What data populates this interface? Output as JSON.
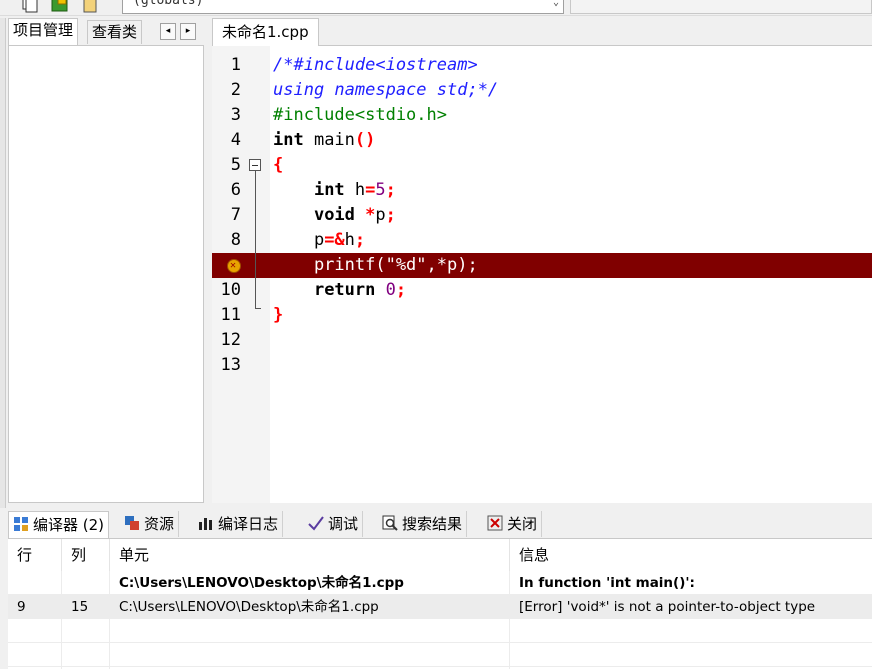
{
  "toolbar": {
    "scope_select": "(globals)"
  },
  "left_tabs": {
    "project": "项目管理",
    "classes": "查看类",
    "prev": "◂",
    "next": "▸"
  },
  "editor": {
    "file_tab": "未命名1.cpp",
    "lines": [
      {
        "n": "1",
        "parts": [
          {
            "t": "/*#include<iostream>",
            "c": "c-comment"
          }
        ]
      },
      {
        "n": "2",
        "parts": [
          {
            "t": "using namespace std;*/",
            "c": "c-comment"
          }
        ]
      },
      {
        "n": "3",
        "parts": [
          {
            "t": "#include<stdio.h>",
            "c": "c-pre"
          }
        ]
      },
      {
        "n": "4",
        "parts": [
          {
            "t": "int",
            "c": "c-kw"
          },
          {
            "t": " main",
            "c": ""
          },
          {
            "t": "()",
            "c": "c-sym"
          }
        ]
      },
      {
        "n": "5",
        "parts": [
          {
            "t": "{",
            "c": "c-sym"
          }
        ]
      },
      {
        "n": "6",
        "parts": [
          {
            "t": "    ",
            "c": ""
          },
          {
            "t": "int",
            "c": "c-kw"
          },
          {
            "t": " h",
            "c": ""
          },
          {
            "t": "=",
            "c": "c-sym"
          },
          {
            "t": "5",
            "c": "c-num"
          },
          {
            "t": ";",
            "c": "c-sym"
          }
        ]
      },
      {
        "n": "7",
        "parts": [
          {
            "t": "    ",
            "c": ""
          },
          {
            "t": "void",
            "c": "c-kw"
          },
          {
            "t": " ",
            "c": ""
          },
          {
            "t": "*",
            "c": "c-sym"
          },
          {
            "t": "p",
            "c": ""
          },
          {
            "t": ";",
            "c": "c-sym"
          }
        ]
      },
      {
        "n": "8",
        "parts": [
          {
            "t": "    p",
            "c": ""
          },
          {
            "t": "=&",
            "c": "c-sym"
          },
          {
            "t": "h",
            "c": ""
          },
          {
            "t": ";",
            "c": "c-sym"
          }
        ]
      },
      {
        "n": "9",
        "parts": [
          {
            "t": "    printf(\"%d\",*p);",
            "c": ""
          }
        ]
      },
      {
        "n": "10",
        "parts": [
          {
            "t": "    ",
            "c": ""
          },
          {
            "t": "return",
            "c": "c-kw"
          },
          {
            "t": " ",
            "c": ""
          },
          {
            "t": "0",
            "c": "c-num"
          },
          {
            "t": ";",
            "c": "c-sym"
          }
        ]
      },
      {
        "n": "11",
        "parts": [
          {
            "t": "}",
            "c": "c-sym"
          }
        ]
      },
      {
        "n": "12",
        "parts": []
      },
      {
        "n": "13",
        "parts": []
      }
    ]
  },
  "bottom_tabs": {
    "compiler": "编译器 (2)",
    "resources": "资源",
    "compile_log": "编译日志",
    "debug": "调试",
    "search_results": "搜索结果",
    "close": "关闭"
  },
  "messages": {
    "headers": {
      "line": "行",
      "col": "列",
      "unit": "单元",
      "info": "信息"
    },
    "rows": [
      {
        "line": "",
        "col": "",
        "unit": "C:\\Users\\LENOVO\\Desktop\\未命名1.cpp",
        "info": "In function 'int main()':",
        "bold": true
      },
      {
        "line": "9",
        "col": "15",
        "unit": "C:\\Users\\LENOVO\\Desktop\\未命名1.cpp",
        "info": "[Error] 'void*' is not a pointer-to-object type",
        "bold": false
      }
    ]
  }
}
